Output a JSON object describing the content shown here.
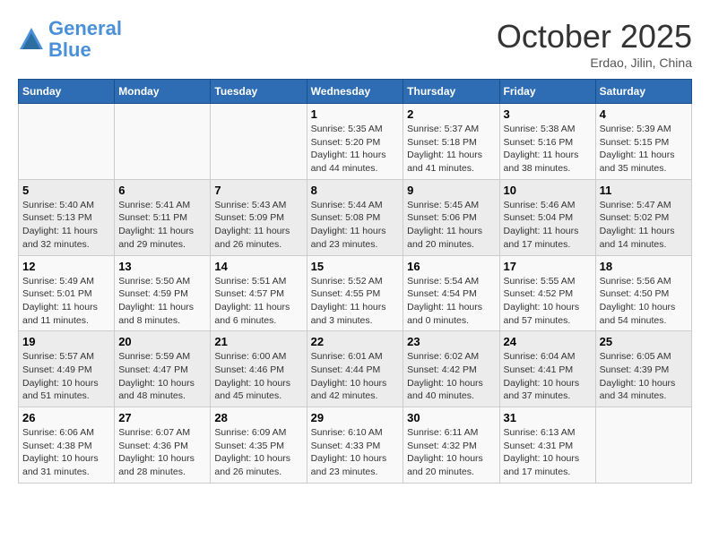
{
  "header": {
    "logo_line1": "General",
    "logo_line2": "Blue",
    "month": "October 2025",
    "location": "Erdao, Jilin, China"
  },
  "days_of_week": [
    "Sunday",
    "Monday",
    "Tuesday",
    "Wednesday",
    "Thursday",
    "Friday",
    "Saturday"
  ],
  "weeks": [
    [
      {
        "day": "",
        "info": ""
      },
      {
        "day": "",
        "info": ""
      },
      {
        "day": "",
        "info": ""
      },
      {
        "day": "1",
        "info": "Sunrise: 5:35 AM\nSunset: 5:20 PM\nDaylight: 11 hours and 44 minutes."
      },
      {
        "day": "2",
        "info": "Sunrise: 5:37 AM\nSunset: 5:18 PM\nDaylight: 11 hours and 41 minutes."
      },
      {
        "day": "3",
        "info": "Sunrise: 5:38 AM\nSunset: 5:16 PM\nDaylight: 11 hours and 38 minutes."
      },
      {
        "day": "4",
        "info": "Sunrise: 5:39 AM\nSunset: 5:15 PM\nDaylight: 11 hours and 35 minutes."
      }
    ],
    [
      {
        "day": "5",
        "info": "Sunrise: 5:40 AM\nSunset: 5:13 PM\nDaylight: 11 hours and 32 minutes."
      },
      {
        "day": "6",
        "info": "Sunrise: 5:41 AM\nSunset: 5:11 PM\nDaylight: 11 hours and 29 minutes."
      },
      {
        "day": "7",
        "info": "Sunrise: 5:43 AM\nSunset: 5:09 PM\nDaylight: 11 hours and 26 minutes."
      },
      {
        "day": "8",
        "info": "Sunrise: 5:44 AM\nSunset: 5:08 PM\nDaylight: 11 hours and 23 minutes."
      },
      {
        "day": "9",
        "info": "Sunrise: 5:45 AM\nSunset: 5:06 PM\nDaylight: 11 hours and 20 minutes."
      },
      {
        "day": "10",
        "info": "Sunrise: 5:46 AM\nSunset: 5:04 PM\nDaylight: 11 hours and 17 minutes."
      },
      {
        "day": "11",
        "info": "Sunrise: 5:47 AM\nSunset: 5:02 PM\nDaylight: 11 hours and 14 minutes."
      }
    ],
    [
      {
        "day": "12",
        "info": "Sunrise: 5:49 AM\nSunset: 5:01 PM\nDaylight: 11 hours and 11 minutes."
      },
      {
        "day": "13",
        "info": "Sunrise: 5:50 AM\nSunset: 4:59 PM\nDaylight: 11 hours and 8 minutes."
      },
      {
        "day": "14",
        "info": "Sunrise: 5:51 AM\nSunset: 4:57 PM\nDaylight: 11 hours and 6 minutes."
      },
      {
        "day": "15",
        "info": "Sunrise: 5:52 AM\nSunset: 4:55 PM\nDaylight: 11 hours and 3 minutes."
      },
      {
        "day": "16",
        "info": "Sunrise: 5:54 AM\nSunset: 4:54 PM\nDaylight: 11 hours and 0 minutes."
      },
      {
        "day": "17",
        "info": "Sunrise: 5:55 AM\nSunset: 4:52 PM\nDaylight: 10 hours and 57 minutes."
      },
      {
        "day": "18",
        "info": "Sunrise: 5:56 AM\nSunset: 4:50 PM\nDaylight: 10 hours and 54 minutes."
      }
    ],
    [
      {
        "day": "19",
        "info": "Sunrise: 5:57 AM\nSunset: 4:49 PM\nDaylight: 10 hours and 51 minutes."
      },
      {
        "day": "20",
        "info": "Sunrise: 5:59 AM\nSunset: 4:47 PM\nDaylight: 10 hours and 48 minutes."
      },
      {
        "day": "21",
        "info": "Sunrise: 6:00 AM\nSunset: 4:46 PM\nDaylight: 10 hours and 45 minutes."
      },
      {
        "day": "22",
        "info": "Sunrise: 6:01 AM\nSunset: 4:44 PM\nDaylight: 10 hours and 42 minutes."
      },
      {
        "day": "23",
        "info": "Sunrise: 6:02 AM\nSunset: 4:42 PM\nDaylight: 10 hours and 40 minutes."
      },
      {
        "day": "24",
        "info": "Sunrise: 6:04 AM\nSunset: 4:41 PM\nDaylight: 10 hours and 37 minutes."
      },
      {
        "day": "25",
        "info": "Sunrise: 6:05 AM\nSunset: 4:39 PM\nDaylight: 10 hours and 34 minutes."
      }
    ],
    [
      {
        "day": "26",
        "info": "Sunrise: 6:06 AM\nSunset: 4:38 PM\nDaylight: 10 hours and 31 minutes."
      },
      {
        "day": "27",
        "info": "Sunrise: 6:07 AM\nSunset: 4:36 PM\nDaylight: 10 hours and 28 minutes."
      },
      {
        "day": "28",
        "info": "Sunrise: 6:09 AM\nSunset: 4:35 PM\nDaylight: 10 hours and 26 minutes."
      },
      {
        "day": "29",
        "info": "Sunrise: 6:10 AM\nSunset: 4:33 PM\nDaylight: 10 hours and 23 minutes."
      },
      {
        "day": "30",
        "info": "Sunrise: 6:11 AM\nSunset: 4:32 PM\nDaylight: 10 hours and 20 minutes."
      },
      {
        "day": "31",
        "info": "Sunrise: 6:13 AM\nSunset: 4:31 PM\nDaylight: 10 hours and 17 minutes."
      },
      {
        "day": "",
        "info": ""
      }
    ]
  ]
}
